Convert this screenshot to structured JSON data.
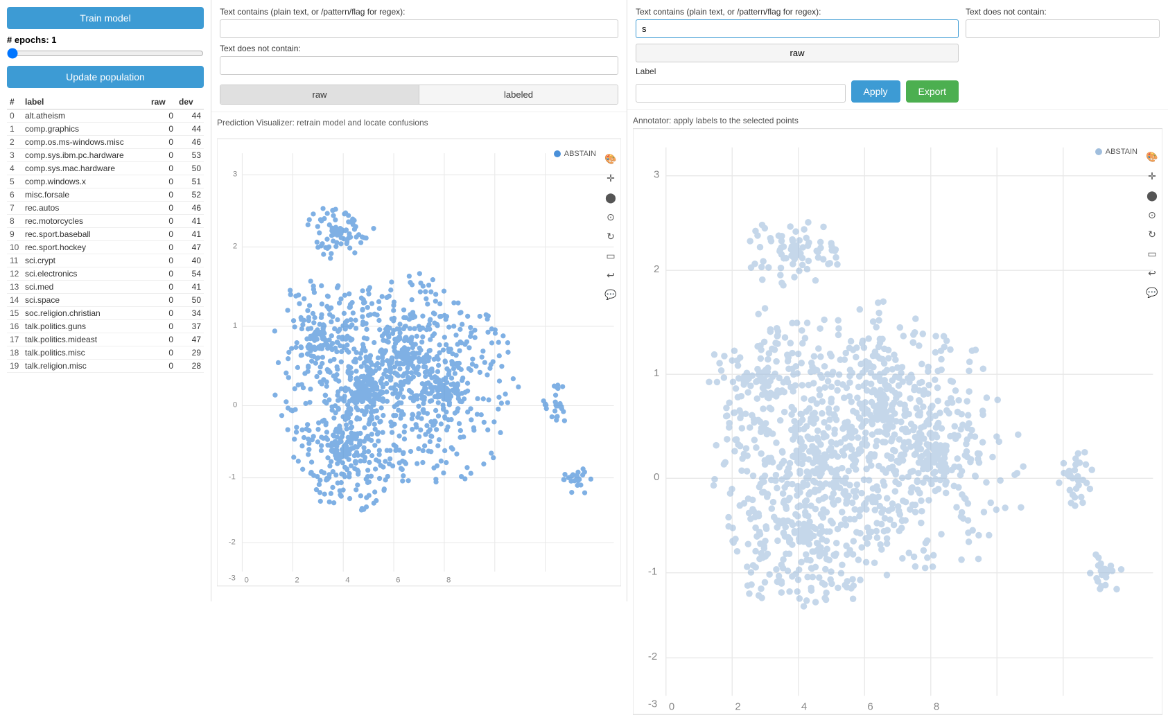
{
  "sidebar": {
    "train_button": "Train model",
    "epochs_label": "# epochs: 1",
    "update_button": "Update population",
    "table": {
      "headers": [
        "#",
        "label",
        "raw",
        "dev"
      ],
      "rows": [
        [
          0,
          "alt.atheism",
          0,
          44
        ],
        [
          1,
          "comp.graphics",
          0,
          44
        ],
        [
          2,
          "comp.os.ms-windows.misc",
          0,
          46
        ],
        [
          3,
          "comp.sys.ibm.pc.hardware",
          0,
          53
        ],
        [
          4,
          "comp.sys.mac.hardware",
          0,
          50
        ],
        [
          5,
          "comp.windows.x",
          0,
          51
        ],
        [
          6,
          "misc.forsale",
          0,
          52
        ],
        [
          7,
          "rec.autos",
          0,
          46
        ],
        [
          8,
          "rec.motorcycles",
          0,
          41
        ],
        [
          9,
          "rec.sport.baseball",
          0,
          41
        ],
        [
          10,
          "rec.sport.hockey",
          0,
          47
        ],
        [
          11,
          "sci.crypt",
          0,
          40
        ],
        [
          12,
          "sci.electronics",
          0,
          54
        ],
        [
          13,
          "sci.med",
          0,
          41
        ],
        [
          14,
          "sci.space",
          0,
          50
        ],
        [
          15,
          "soc.religion.christian",
          0,
          34
        ],
        [
          16,
          "talk.politics.guns",
          0,
          37
        ],
        [
          17,
          "talk.politics.mideast",
          0,
          47
        ],
        [
          18,
          "talk.politics.misc",
          0,
          29
        ],
        [
          19,
          "talk.religion.misc",
          0,
          28
        ]
      ]
    }
  },
  "prediction_visualizer": {
    "filter_label": "Text contains (plain text, or /pattern/flag for regex):",
    "filter_placeholder": "",
    "not_contain_label": "Text does not contain:",
    "not_contain_placeholder": "",
    "tab_raw": "raw",
    "tab_labeled": "labeled",
    "title": "Prediction Visualizer: retrain model and locate confusions",
    "legend_label": "ABSTAIN",
    "legend_color": "#4a90d9"
  },
  "annotator": {
    "filter_label": "Text contains (plain text, or /pattern/flag for regex):",
    "filter_value": "s",
    "not_contain_label": "Text does not contain:",
    "not_contain_placeholder": "",
    "raw_btn": "raw",
    "label_label": "Label",
    "label_placeholder": "",
    "apply_btn": "Apply",
    "export_btn": "Export",
    "title": "Annotator: apply labels to the selected points",
    "legend_label": "ABSTAIN",
    "legend_color": "#a0bedd"
  },
  "colors": {
    "primary": "#3d9bd4",
    "dot_blue": "#4a90d9",
    "dot_light_blue": "#a0bedd",
    "green": "#4caf50"
  }
}
